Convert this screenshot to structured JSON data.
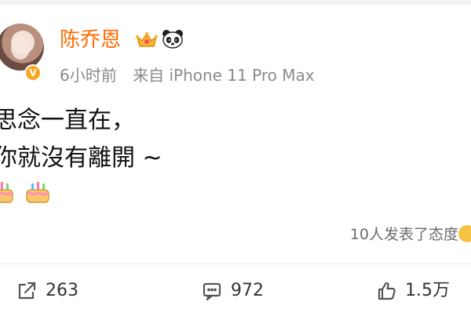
{
  "header": {
    "name": "陈乔恩",
    "time": "6小时前",
    "source": "来自 iPhone 11 Pro Max"
  },
  "post": {
    "line_1": "思念一直在，",
    "line_2": "你就沒有離開 ~",
    "emoji": [
      "cake",
      "cake"
    ]
  },
  "reaction_summary": "10人发表了态度",
  "actions": {
    "repost_count": "263",
    "comment_count": "972",
    "like_count": "1.5万"
  },
  "icons": {
    "crown": "crown-icon",
    "panda": "panda-icon",
    "verified": "verified-badge",
    "repost": "share-icon",
    "comment": "comment-icon",
    "like": "like-icon",
    "cake": "cake-icon",
    "reaction": "emoji-face-icon"
  },
  "colors": {
    "name": "#ff6a00",
    "meta": "#8a8a8a",
    "text": "#111111",
    "verified": "#f6a623"
  }
}
